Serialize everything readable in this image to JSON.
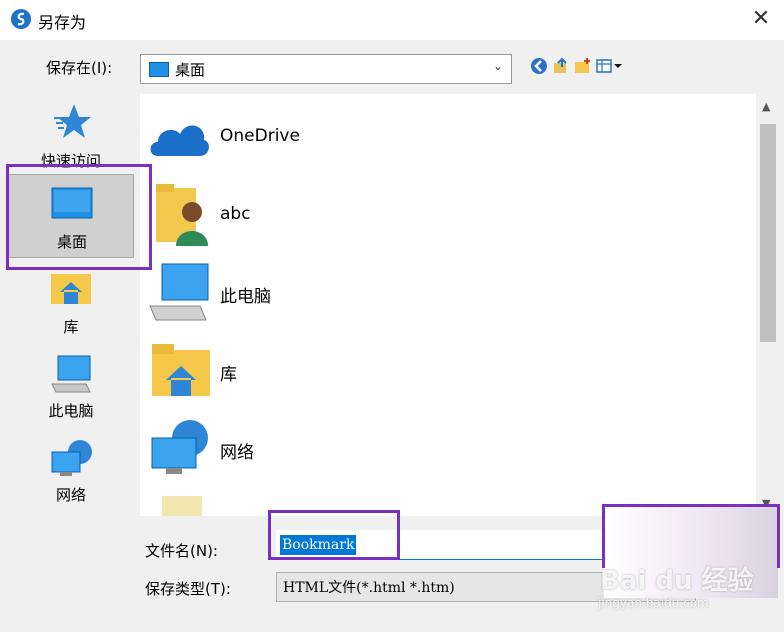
{
  "window": {
    "title": "另存为"
  },
  "location": {
    "label": "保存在(I):",
    "current": "桌面"
  },
  "sidebar": {
    "items": [
      {
        "label": "快速访问",
        "icon": "star-icon"
      },
      {
        "label": "桌面",
        "icon": "desktop-icon",
        "selected": true
      },
      {
        "label": "库",
        "icon": "library-icon"
      },
      {
        "label": "此电脑",
        "icon": "computer-icon"
      },
      {
        "label": "网络",
        "icon": "network-icon"
      }
    ]
  },
  "files": [
    {
      "name": "OneDrive",
      "icon": "cloud-icon"
    },
    {
      "name": "abc",
      "icon": "user-folder-icon"
    },
    {
      "name": "此电脑",
      "icon": "computer-icon"
    },
    {
      "name": "库",
      "icon": "library-folder-icon"
    },
    {
      "name": "网络",
      "icon": "network-icon"
    }
  ],
  "filename": {
    "label": "文件名(N):",
    "value": "Bookmark"
  },
  "filetype": {
    "label": "保存类型(T):",
    "value": "HTML文件(*.html *.htm)"
  },
  "watermark": {
    "brand": "Bai du 经验",
    "url": "jingyan.baidu.com"
  },
  "colors": {
    "annotation": "#7b2fbf",
    "selection": "#0078d7",
    "accent": "#1e90e6"
  }
}
